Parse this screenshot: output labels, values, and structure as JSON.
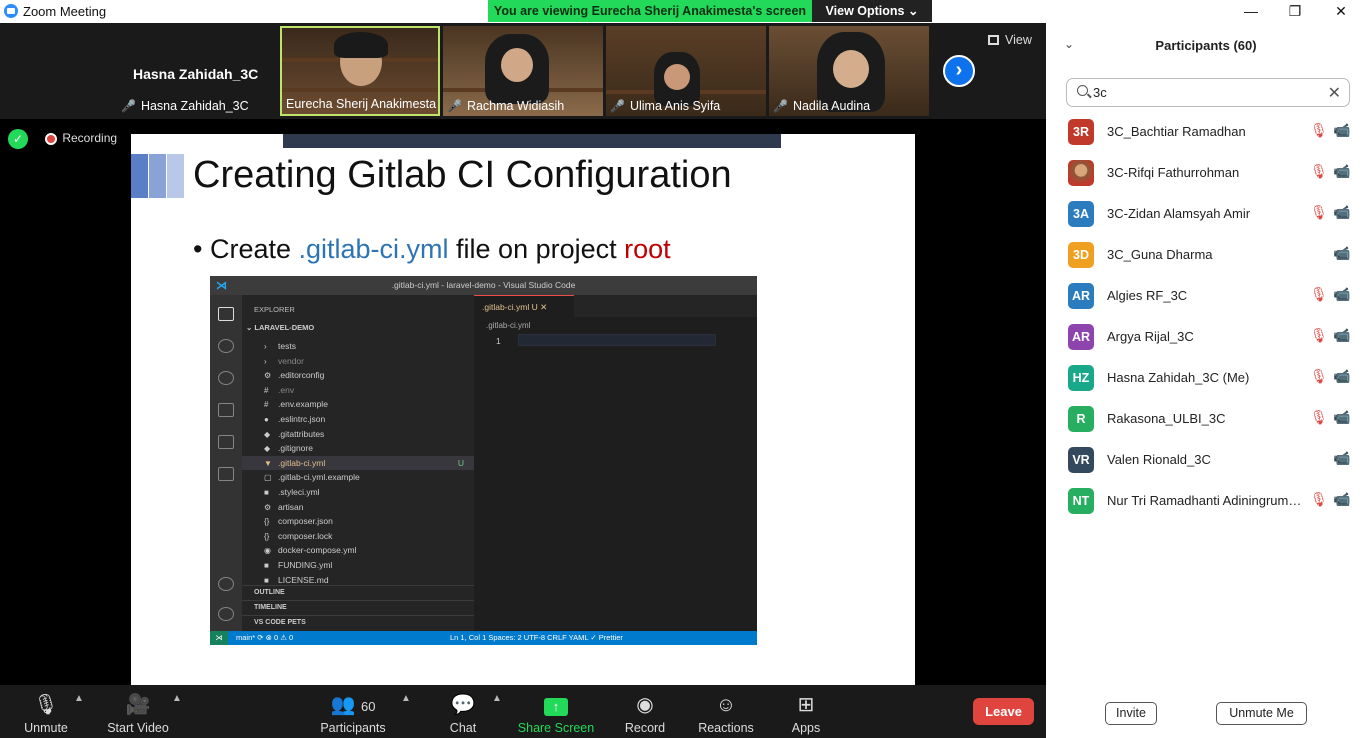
{
  "window": {
    "title": "Zoom Meeting",
    "minimize": "—",
    "maximize": "❐",
    "close": "✕"
  },
  "banner": {
    "viewing_text": "You are viewing Eurecha Sherij Anakimesta's screen",
    "options_label": "View Options ⌄"
  },
  "gallery": {
    "active_speaker": "Hasna Zahidah_3C",
    "tiles": [
      {
        "name": "Hasna Zahidah_3C",
        "muted": true
      },
      {
        "name": "Eurecha Sherij Anakimesta",
        "muted": false
      },
      {
        "name": "Rachma Widiasih",
        "muted": true
      },
      {
        "name": "Ulima Anis Syifa",
        "muted": true
      },
      {
        "name": "Nadila Audina",
        "muted": true
      }
    ],
    "next_icon": "›",
    "view_label": "View"
  },
  "recording": {
    "label": "Recording",
    "shield_icon": "✓"
  },
  "slide": {
    "heading": "Creating Gitlab CI Configuration",
    "bullet_prefix": "• Create ",
    "bullet_file": ".gitlab-ci.yml",
    "bullet_middle": " file on project ",
    "bullet_root": "root",
    "colors": {
      "block1": "#5b7fc7",
      "block2": "#8aa3d6",
      "block3": "#b9c8e8",
      "blue": "#2e74b5",
      "red": "#c00000"
    }
  },
  "vscode": {
    "window_title": ".gitlab-ci.yml - laravel-demo - Visual Studio Code",
    "explorer_label": "EXPLORER",
    "project": "LARAVEL-DEMO",
    "files": [
      {
        "name": "tests",
        "icon": "›",
        "color": "#ccc"
      },
      {
        "name": "vendor",
        "icon": "›",
        "color": "#888"
      },
      {
        "name": ".editorconfig",
        "icon": "⚙",
        "color": "#ccc"
      },
      {
        "name": ".env",
        "icon": "#",
        "color": "#888"
      },
      {
        "name": ".env.example",
        "icon": "#",
        "color": "#ccc"
      },
      {
        "name": ".eslintrc.json",
        "icon": "●",
        "color": "#ccc"
      },
      {
        "name": ".gitattributes",
        "icon": "◆",
        "color": "#ccc"
      },
      {
        "name": ".gitignore",
        "icon": "◆",
        "color": "#ccc"
      },
      {
        "name": ".gitlab-ci.yml",
        "icon": "▼",
        "color": "#e2c08d",
        "selected": true,
        "badge": "U"
      },
      {
        "name": ".gitlab-ci.yml.example",
        "icon": "▢",
        "color": "#ccc"
      },
      {
        "name": ".styleci.yml",
        "icon": "■",
        "color": "#ccc"
      },
      {
        "name": "artisan",
        "icon": "⚙",
        "color": "#ccc"
      },
      {
        "name": "composer.json",
        "icon": "{}",
        "color": "#ccc"
      },
      {
        "name": "composer.lock",
        "icon": "{}",
        "color": "#ccc"
      },
      {
        "name": "docker-compose.yml",
        "icon": "◉",
        "color": "#ccc"
      },
      {
        "name": "FUNDING.yml",
        "icon": "■",
        "color": "#ccc"
      },
      {
        "name": "LICENSE.md",
        "icon": "■",
        "color": "#ccc"
      }
    ],
    "sections": [
      "OUTLINE",
      "TIMELINE",
      "VS CODE PETS"
    ],
    "tab_label": ".gitlab-ci.yml U ✕",
    "breadcrumb": ".gitlab-ci.yml",
    "line_number": "1",
    "status_left": "main*   ⟳   ⊗ 0 ⚠ 0",
    "status_right": "Ln 1, Col 1    Spaces: 2    UTF-8    CRLF    YAML    ✓ Prettier"
  },
  "toolbar": {
    "unmute": "Unmute",
    "start_video": "Start Video",
    "participants": "Participants",
    "participants_count": "60",
    "chat": "Chat",
    "share_screen": "Share Screen",
    "record": "Record",
    "reactions": "Reactions",
    "apps": "Apps",
    "leave": "Leave"
  },
  "panel": {
    "title": "Participants (60)",
    "search_value": "3c",
    "participants": [
      {
        "initials": "3R",
        "name": "3C_Bachtiar Ramadhan",
        "color": "#c0392b",
        "mic_muted": true
      },
      {
        "initials": "",
        "name": "3C-Rifqi Fathurrohman",
        "color": "#8a5a3a",
        "mic_muted": true,
        "photo": true
      },
      {
        "initials": "3A",
        "name": "3C-Zidan Alamsyah Amir",
        "color": "#2b7bbf",
        "mic_muted": true
      },
      {
        "initials": "3D",
        "name": "3C_Guna Dharma",
        "color": "#f0a020",
        "mic_muted": false
      },
      {
        "initials": "AR",
        "name": "Algies RF_3C",
        "color": "#2b7bbf",
        "mic_muted": true
      },
      {
        "initials": "AR",
        "name": "Argya Rijal_3C",
        "color": "#8e44ad",
        "mic_muted": true
      },
      {
        "initials": "HZ",
        "name": "Hasna Zahidah_3C (Me)",
        "color": "#1aa88a",
        "mic_muted": true
      },
      {
        "initials": "R",
        "name": "Rakasona_ULBI_3C",
        "color": "#27ae60",
        "mic_muted": true
      },
      {
        "initials": "VR",
        "name": "Valen Rionald_3C",
        "color": "#34495e",
        "mic_muted": false
      },
      {
        "initials": "NT",
        "name": "Nur Tri Ramadhanti Adiningrum_3C",
        "color": "#27ae60",
        "mic_muted": true
      }
    ],
    "invite": "Invite",
    "unmute_me": "Unmute Me"
  }
}
